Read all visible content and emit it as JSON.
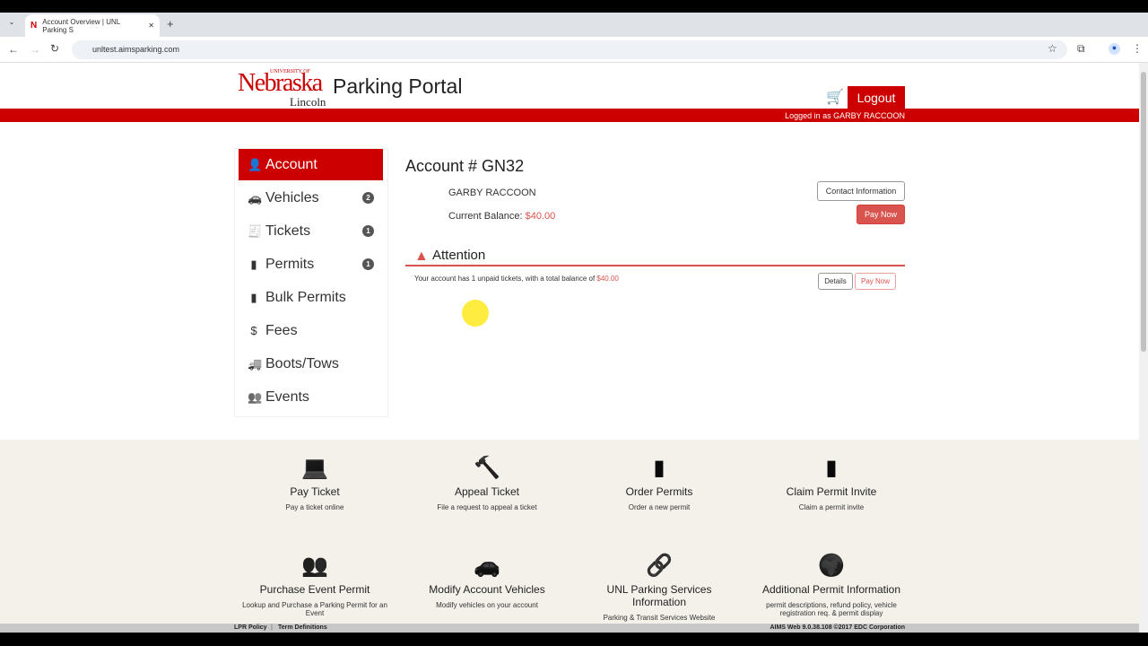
{
  "browser": {
    "tab_title": "Account Overview | UNL Parking S",
    "url": "unltest.aimsparking.com"
  },
  "header": {
    "logo_top": "UNIVERSITY OF",
    "logo_main": "Nebraska",
    "logo_sub": "Lincoln",
    "title": "Parking Portal",
    "logout": "Logout",
    "logged_in": "Logged in as GARBY RACCOON"
  },
  "sidebar": {
    "items": [
      {
        "label": "Account",
        "icon": "user-icon",
        "glyph": "👤",
        "badge": null
      },
      {
        "label": "Vehicles",
        "icon": "car-icon",
        "glyph": "🚗",
        "badge": "2"
      },
      {
        "label": "Tickets",
        "icon": "ticket-icon",
        "glyph": "🧾",
        "badge": "1"
      },
      {
        "label": "Permits",
        "icon": "permit-hanger-icon",
        "glyph": "▮",
        "badge": "1"
      },
      {
        "label": "Bulk Permits",
        "icon": "permit-hanger-icon",
        "glyph": "▮",
        "badge": null
      },
      {
        "label": "Fees",
        "icon": "dollar-icon",
        "glyph": "$",
        "badge": null
      },
      {
        "label": "Boots/Tows",
        "icon": "tow-truck-icon",
        "glyph": "🚚",
        "badge": null
      },
      {
        "label": "Events",
        "icon": "group-icon",
        "glyph": "👥",
        "badge": null
      }
    ]
  },
  "account": {
    "title": "Account # GN32",
    "name": "GARBY RACCOON",
    "balance_label": "Current Balance:",
    "balance": "$40.00",
    "contact": "Contact Information",
    "pay_now": "Pay Now"
  },
  "attention": {
    "title": "Attention",
    "msg_pre": "Your account has ",
    "count": "1",
    "msg_mid": " unpaid tickets, with a total balance of ",
    "amount": "$40.00",
    "details": "Details",
    "pay_now": "Pay Now"
  },
  "tiles": [
    {
      "title": "Pay Ticket",
      "desc": "Pay a ticket online",
      "icon": "laptop-dollar-icon",
      "glyph": "💻"
    },
    {
      "title": "Appeal Ticket",
      "desc": "File a request to appeal a ticket",
      "icon": "gavel-icon",
      "glyph": "🔨"
    },
    {
      "title": "Order Permits",
      "desc": "Order a new permit",
      "icon": "permit-hanger-icon",
      "glyph": "▮"
    },
    {
      "title": "Claim Permit Invite",
      "desc": "Claim a permit invite",
      "icon": "permit-hanger-icon",
      "glyph": "▮"
    },
    {
      "title": "Purchase Event Permit",
      "desc": "Lookup and Purchase a Parking Permit for an Event",
      "icon": "group-icon",
      "glyph": "👥"
    },
    {
      "title": "Modify Account Vehicles",
      "desc": "Modify vehicles on your account",
      "icon": "car-icon",
      "glyph": "🚗"
    },
    {
      "title": "UNL Parking Services Information",
      "desc": "Parking & Transit Services Website",
      "icon": "link-icon",
      "glyph": "🔗"
    },
    {
      "title": "Additional Permit Information",
      "desc": "permit descriptions, refund policy, vehicle registration req. & permit display",
      "icon": "globe-icon",
      "glyph": "🌍"
    }
  ],
  "footer": {
    "lpr": "LPR Policy",
    "terms": "Term Definitions",
    "version": "AIMS Web 9.0.38.108 ©2017 EDC Corporation"
  },
  "colors": {
    "brand": "#cc0000",
    "accent": "#d9534f"
  }
}
